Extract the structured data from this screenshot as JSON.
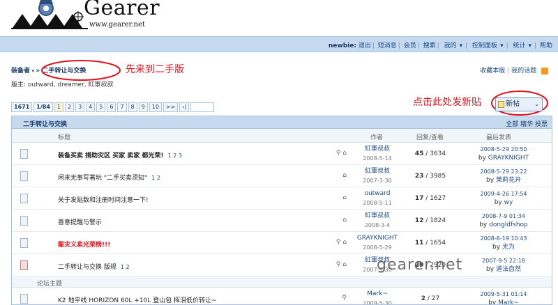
{
  "logo": {
    "brand": "Gearer",
    "url": "www.gearer.net"
  },
  "topbar": {
    "user": "newbie:",
    "items": [
      "退出",
      "短消息",
      "会员",
      "搜索",
      "我的",
      "控制面板",
      "统计",
      "帮助"
    ]
  },
  "breadcrumb": {
    "parent": "装备者",
    "current": "二手转让与交换"
  },
  "annotation_top": "先来到二手版",
  "annotation_new": "点击此处发新贴",
  "moderators": "版主: outward, dreamer, 紅軍叔叔",
  "right_links": {
    "favorite": "收藏本版",
    "my_topics": "我的话题"
  },
  "pager": {
    "total": "1671",
    "pages": "1/84",
    "nums": [
      "1",
      "2",
      "3",
      "4",
      "5",
      "6",
      "7",
      "8",
      "9",
      "10",
      ">>",
      "›|"
    ]
  },
  "new_button": "新帖",
  "table": {
    "title": "二手转让与交换",
    "filters": "全部  精华  投票",
    "headers": {
      "title": "标题",
      "author": "作者",
      "replies": "回复/查看",
      "last": "最后发表"
    },
    "section": "论坛主题",
    "rows": [
      {
        "title": "装备买卖  捐助灾区  买家  卖家  都光荣!",
        "pages": "1 2 3",
        "author": "紅軍叔叔",
        "date": "2008-5-14",
        "replies": "45",
        "views": "3634",
        "last_time": "2008-5-29 20:50",
        "last_by": "GRAYKNIGHT"
      },
      {
        "title": "闲来无事写著玩 \"二手买卖须知\"",
        "pages": "1 2",
        "author": "紅軍叔叔",
        "date": "2007-3-30",
        "replies": "23",
        "views": "3985",
        "last_time": "2008-5-29 23:22",
        "last_by": "茉莉花开"
      },
      {
        "title": "关于发贴数和注册时间注意一下!",
        "pages": "",
        "author": "outward",
        "date": "2008-5-11",
        "replies": "17",
        "views": "1627",
        "last_time": "2009-4-26 17:54",
        "last_by": "wy"
      },
      {
        "title": "善意提醒与警示",
        "pages": "",
        "author": "紅軍叔叔",
        "date": "2008-3-4",
        "replies": "12",
        "views": "1824",
        "last_time": "2008-7-9 01:34",
        "last_by": "dongldfshop"
      },
      {
        "title": "赈灾义卖光荣榜!!!",
        "pages": "",
        "author": "GRAYKNIGHT",
        "date": "2008-5-29",
        "replies": "11",
        "views": "1654",
        "last_time": "2008-6-19 10:43",
        "last_by": "无为"
      },
      {
        "title": "二手转让与交换   版规",
        "pages": "1 2",
        "author": "紅軍叔叔",
        "date": "2007-3-30",
        "replies": "29",
        "views": "2920",
        "last_time": "2007-9-5 22:18",
        "last_by": "道法自然"
      }
    ],
    "normal_row": {
      "title": "K2 地平线  HORIZON 60L +10L 登山包  挥泪低价转让~",
      "author": "Mark~",
      "date": "2009-5-30",
      "replies": "2",
      "views": "27",
      "last_time": "2009-5-31 01:14",
      "last_by": "Mark~"
    }
  },
  "watermark": "gearer.net",
  "colors": {
    "accent": "#1b4a85",
    "header_bg": "#c5d9ef",
    "annotation": "#e0141e"
  }
}
